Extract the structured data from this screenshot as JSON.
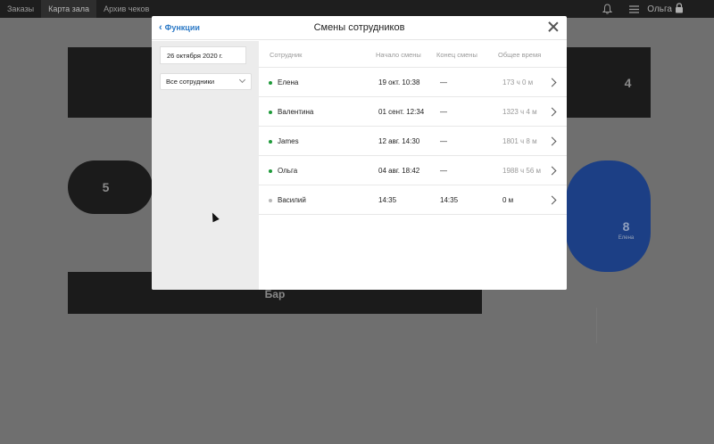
{
  "topbar": {
    "tabs": [
      {
        "label": "Заказы",
        "active": false
      },
      {
        "label": "Карта зала",
        "active": true
      },
      {
        "label": "Архив чеков",
        "active": false
      }
    ],
    "user_name": "Ольга",
    "icons": [
      "bell-icon",
      "menu-icon",
      "lock-icon"
    ]
  },
  "floor": {
    "tables": [
      {
        "label": "",
        "sub": ""
      },
      {
        "label": "4",
        "sub": ""
      },
      {
        "label": "5",
        "sub": ""
      },
      {
        "label": "8",
        "sub": "Елена"
      },
      {
        "label": "Бар",
        "sub": ""
      }
    ]
  },
  "modal": {
    "back_label": "Функции",
    "title": "Смены сотрудников",
    "date": "26 октября 2020 г.",
    "filter_value": "Все сотрудники",
    "columns": {
      "employee": "Сотрудник",
      "start": "Начало смены",
      "end": "Конец смены",
      "total": "Общее время"
    },
    "rows": [
      {
        "name": "Елена",
        "start": "19 окт. 10:38",
        "end": "—",
        "total": "173 ч 0 м",
        "active": true
      },
      {
        "name": "Валентина",
        "start": "01 сент. 12:34",
        "end": "—",
        "total": "1323 ч 4 м",
        "active": true
      },
      {
        "name": "James",
        "start": "12 авг. 14:30",
        "end": "—",
        "total": "1801 ч 8 м",
        "active": true
      },
      {
        "name": "Ольга",
        "start": "04 авг. 18:42",
        "end": "—",
        "total": "1988 ч 56 м",
        "active": true
      },
      {
        "name": "Василий",
        "start": "14:35",
        "end": "14:35",
        "total": "0 м",
        "active": false
      }
    ]
  },
  "colors": {
    "accent": "#2b79c6",
    "active_dot": "#1f9a3a",
    "inactive_dot": "#b8b8b8",
    "occupied_table": "#1c3f85"
  }
}
